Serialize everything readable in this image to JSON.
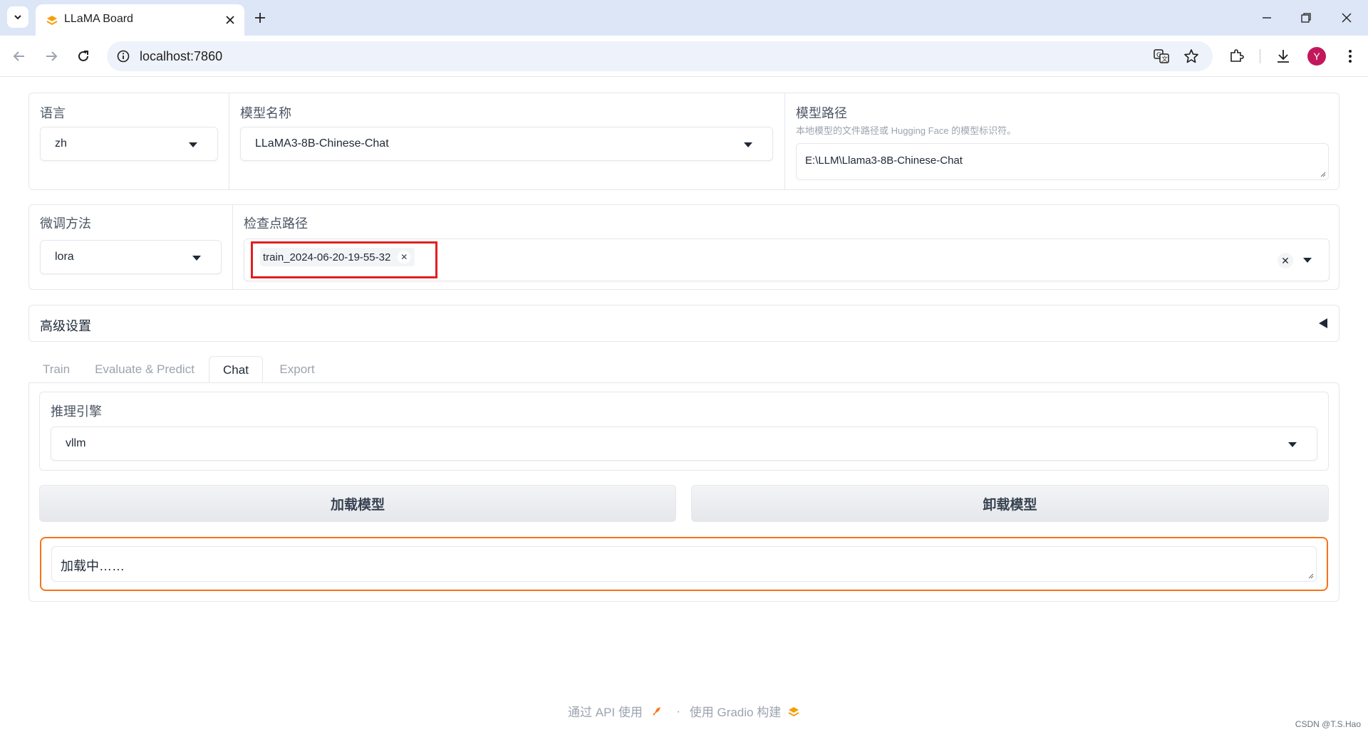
{
  "browser": {
    "tab_title": "LLaMA Board",
    "url": "localhost:7860",
    "avatar_letter": "Y"
  },
  "model_row": {
    "language": {
      "label": "语言",
      "value": "zh"
    },
    "model_name": {
      "label": "模型名称",
      "value": "LLaMA3-8B-Chinese-Chat"
    },
    "model_path": {
      "label": "模型路径",
      "info": "本地模型的文件路径或 Hugging Face 的模型标识符。",
      "value": "E:\\LLM\\Llama3-8B-Chinese-Chat"
    }
  },
  "finetune_row": {
    "method": {
      "label": "微调方法",
      "value": "lora"
    },
    "checkpoint": {
      "label": "检查点路径",
      "chips": [
        "train_2024-06-20-19-55-32"
      ]
    }
  },
  "advanced": {
    "label": "高级设置"
  },
  "tabs": [
    {
      "label": "Train",
      "selected": false
    },
    {
      "label": "Evaluate & Predict",
      "selected": false
    },
    {
      "label": "Chat",
      "selected": true
    },
    {
      "label": "Export",
      "selected": false
    }
  ],
  "chat_panel": {
    "engine": {
      "label": "推理引擎",
      "value": "vllm"
    },
    "load_button": "加载模型",
    "unload_button": "卸载模型",
    "status": "加载中……"
  },
  "footer": {
    "api_text": "通过 API 使用",
    "separator": "·",
    "built_with": "使用 Gradio 构建"
  },
  "watermark": "CSDN @T.S.Hao",
  "colors": {
    "accent_orange": "#f97316",
    "highlight_red": "#e02020",
    "chrome_blue": "#dde6f7",
    "avatar": "#c2185b"
  }
}
